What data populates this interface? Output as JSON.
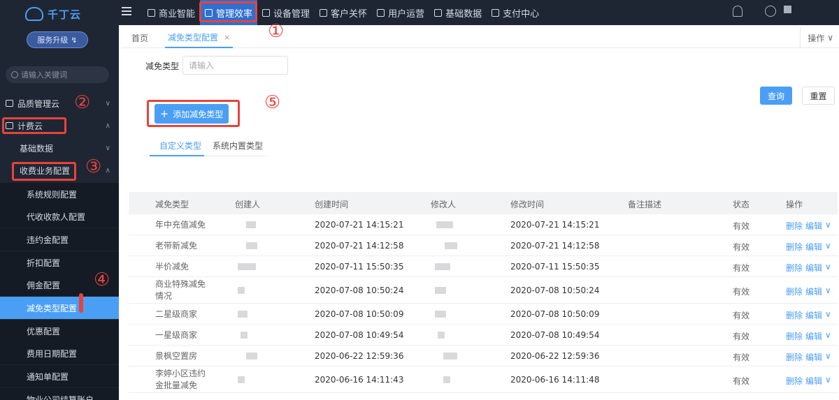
{
  "brand": {
    "name": "千丁云",
    "upgrade": "服务升级",
    "upgrade_icon": "↯"
  },
  "sidebar": {
    "search_placeholder": "请输入关键词",
    "items": [
      {
        "label": "品质管理云",
        "level": 0,
        "chev": "∨"
      },
      {
        "label": "计费云",
        "level": 0,
        "chev": "∧"
      },
      {
        "label": "基础数据",
        "level": 1,
        "chev": "∨"
      },
      {
        "label": "收费业务配置",
        "level": 1,
        "chev": "∧"
      },
      {
        "label": "系统规则配置",
        "level": 2
      },
      {
        "label": "代收收款人配置",
        "level": 2
      },
      {
        "label": "违约金配置",
        "level": 2
      },
      {
        "label": "折扣配置",
        "level": 2
      },
      {
        "label": "佣金配置",
        "level": 2
      },
      {
        "label": "减免类型配置",
        "level": 2,
        "active": true
      },
      {
        "label": "优惠配置",
        "level": 2
      },
      {
        "label": "费用日期配置",
        "level": 2
      },
      {
        "label": "通知单配置",
        "level": 2
      },
      {
        "label": "物业公司结算账户",
        "level": 2
      }
    ]
  },
  "topnav": {
    "items": [
      {
        "label": "商业智能"
      },
      {
        "label": "管理效率",
        "active": true
      },
      {
        "label": "设备管理"
      },
      {
        "label": "客户关怀"
      },
      {
        "label": "用户运营"
      },
      {
        "label": "基础数据"
      },
      {
        "label": "支付中心"
      }
    ]
  },
  "tabs": {
    "home": "首页",
    "current": "减免类型配置",
    "close": "×",
    "ops": "操作",
    "ops_chev": "∨"
  },
  "filter": {
    "label": "减免类型",
    "placeholder": "请输入"
  },
  "buttons": {
    "query": "查询",
    "reset": "重置",
    "add": "添加减免类型",
    "add_icon": "+"
  },
  "subtabs": [
    "自定义类型",
    "系统内置类型"
  ],
  "table": {
    "columns": [
      "减免类型",
      "创建人",
      "创建时间",
      "修改人",
      "修改时间",
      "备注描述",
      "状态",
      "操作"
    ],
    "rows": [
      {
        "name": "年中充值减免",
        "created": "2020-07-21 14:15:21",
        "modified": "2020-07-21 14:15:21",
        "status": "有效"
      },
      {
        "name": "老带新减免",
        "created": "2020-07-21 14:12:58",
        "modified": "2020-07-21 14:12:58",
        "status": "有效"
      },
      {
        "name": "半价减免",
        "created": "2020-07-11 15:50:35",
        "modified": "2020-07-11 15:50:35",
        "status": "有效"
      },
      {
        "name": "商业特殊减免情况",
        "created": "2020-07-08 10:50:24",
        "modified": "2020-07-08 10:50:24",
        "status": "有效"
      },
      {
        "name": "二星级商家",
        "created": "2020-07-08 10:50:09",
        "modified": "2020-07-08 10:50:09",
        "status": "有效"
      },
      {
        "name": "一星级商家",
        "created": "2020-07-08 10:49:54",
        "modified": "2020-07-08 10:49:54",
        "status": "有效"
      },
      {
        "name": "景枫空置房",
        "created": "2020-06-22 12:59:36",
        "modified": "2020-06-22 12:59:36",
        "status": "有效"
      },
      {
        "name": "李婷小区违约金批量减免",
        "created": "2020-06-16 14:11:43",
        "modified": "2020-06-16 14:11:48",
        "status": "有效"
      }
    ],
    "actions": {
      "delete": "删除",
      "edit": "编辑",
      "more": "∨"
    }
  },
  "annotations": [
    "①",
    "②",
    "③",
    "④",
    "⑤"
  ],
  "colors": {
    "accent": "#4a9ff5",
    "sidebar_bg": "#1f2633",
    "annotation": "#e8433a"
  }
}
